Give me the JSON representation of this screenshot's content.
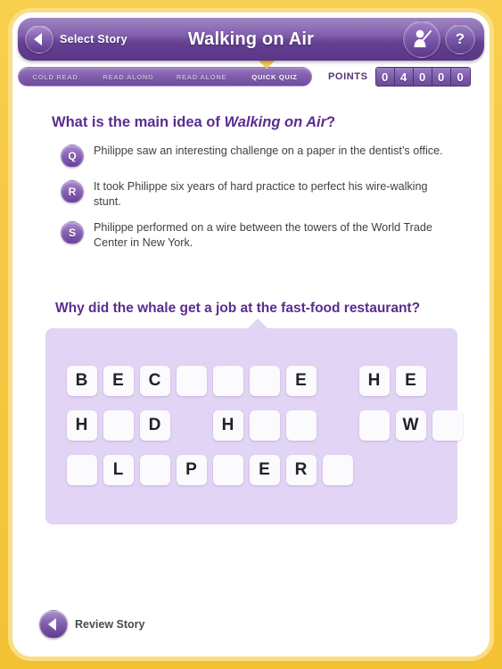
{
  "header": {
    "back_label": "Select Story",
    "title": "Walking on Air",
    "avatar_icon": "teacher-avatar-icon",
    "help_label": "?"
  },
  "tabs": [
    {
      "label": "COLD READ",
      "active": false
    },
    {
      "label": "READ ALONG",
      "active": false
    },
    {
      "label": "READ ALONE",
      "active": false
    },
    {
      "label": "QUICK QUIZ",
      "active": true
    }
  ],
  "points": {
    "label": "POINTS",
    "digits": [
      "0",
      "4",
      "0",
      "0",
      "0"
    ]
  },
  "quiz": {
    "heading_prefix": "What is the main idea of ",
    "heading_title": "Walking on Air",
    "heading_suffix": "?",
    "options": [
      {
        "badge": "Q",
        "text": "Philippe saw an interesting challenge on a paper in the dentist’s office."
      },
      {
        "badge": "R",
        "text": "It took Philippe six years of hard practice to perfect his wire-walking stunt."
      },
      {
        "badge": "S",
        "text": "Philippe performed on a wire between the towers of the World Trade Center in New York."
      }
    ]
  },
  "riddle": {
    "heading": "Why did the whale get a job at the fast-food restaurant?",
    "rows": [
      [
        "B",
        "E",
        "C",
        "",
        "",
        "",
        "E",
        " ",
        "H",
        "E"
      ],
      [
        "H",
        "",
        "D",
        " ",
        "H",
        "",
        "",
        " ",
        "",
        "W",
        ""
      ],
      [
        "",
        "L",
        "",
        "P",
        "",
        "E",
        "R",
        ""
      ]
    ]
  },
  "footer": {
    "review_label": "Review Story"
  },
  "colors": {
    "frame": "#f6c945",
    "header_purple": "#643f91",
    "heading_purple": "#5b2d8e",
    "panel_lavender": "#e2d4f5",
    "marker_yellow": "#f6c945"
  }
}
